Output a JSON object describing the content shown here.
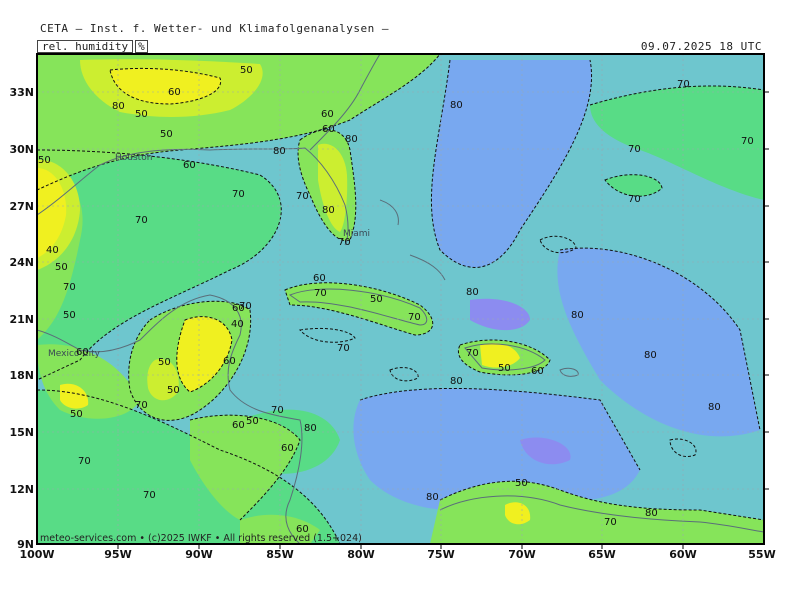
{
  "header": {
    "title": "CETA – Inst. f. Wetter- und Klimafolgenanalysen –",
    "variable": "rel. humidity",
    "unit": "%",
    "datetime": "09.07.2025 18 UTC"
  },
  "footer": {
    "credit": "meteo-services.com • (c)2025 IWKF • All rights reserved (1.5+024)"
  },
  "axes": {
    "lon_labels": [
      "100W",
      "95W",
      "90W",
      "85W",
      "80W",
      "75W",
      "70W",
      "65W",
      "60W",
      "55W"
    ],
    "lat_labels": [
      "33N",
      "30N",
      "27N",
      "24N",
      "21N",
      "18N",
      "15N",
      "12N",
      "9N"
    ]
  },
  "cities": [
    "Houston",
    "Miami",
    "Mexico City"
  ],
  "contour_labels": {
    "values": [
      "40",
      "50",
      "60",
      "70",
      "80"
    ]
  },
  "colors": {
    "v40": "#f0f020",
    "v50": "#ccee30",
    "v60": "#86e45a",
    "v70": "#58dc86",
    "v80": "#6ec6ce",
    "v90": "#78a8f0",
    "v100": "#8c8cf0",
    "land_border": "#5a6e7a"
  }
}
